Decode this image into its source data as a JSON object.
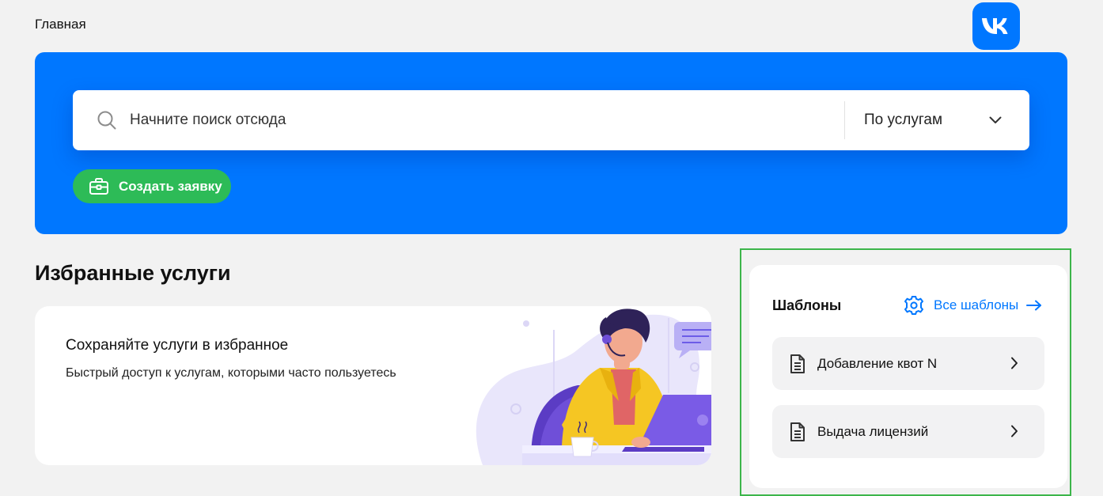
{
  "header": {
    "breadcrumb": "Главная",
    "logo_icon": "vk-logo-icon",
    "logo_color": "#0077ff"
  },
  "hero": {
    "background": "#0077ff",
    "search": {
      "placeholder": "Начните поиск отсюда",
      "value": "",
      "icon": "search-icon",
      "scope": {
        "selected": "По услугам",
        "icon": "chevron-down-icon"
      }
    },
    "create_button": {
      "label": "Создать заявку",
      "icon": "briefcase-icon",
      "color": "#2dbb57"
    }
  },
  "favorites": {
    "title": "Избранные услуги",
    "empty_card": {
      "title": "Сохраняйте услуги в избранное",
      "text": "Быстрый доступ к услугам, которыми часто пользуетесь",
      "illustration": "support-operator-illustration"
    }
  },
  "templates": {
    "title": "Шаблоны",
    "all_link": {
      "label": "Все шаблоны",
      "icon": "gear-icon",
      "arrow_icon": "arrow-right-icon",
      "color": "#0077ff"
    },
    "items": [
      {
        "label": "Добавление квот N",
        "icon": "document-icon",
        "chevron": "chevron-right-icon"
      },
      {
        "label": "Выдача лицензий",
        "icon": "document-icon",
        "chevron": "chevron-right-icon"
      }
    ],
    "highlight_color": "#3cb54a"
  }
}
